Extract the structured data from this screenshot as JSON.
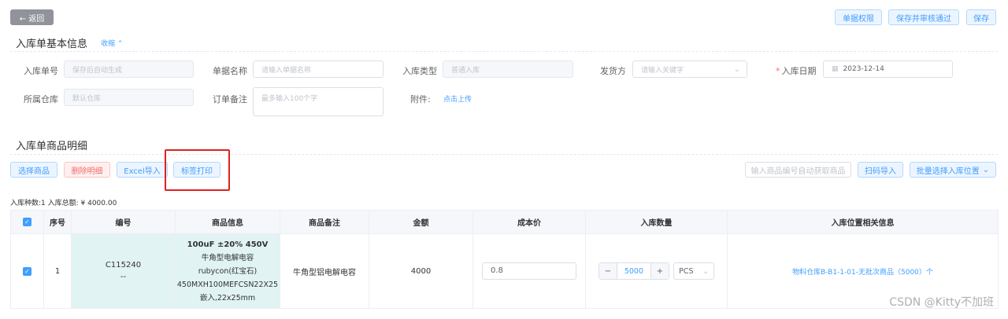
{
  "toolbar": {
    "back_label": "← 返回",
    "permission_label": "单据权限",
    "save_approve_label": "保存并审核通过",
    "save_label": "保存"
  },
  "basic": {
    "title": "入库单基本信息",
    "collapse_label": "收缩",
    "order_no": {
      "label": "入库单号",
      "placeholder": "保存后自动生成"
    },
    "doc_name": {
      "label": "单据名称",
      "placeholder": "请输入单据名称"
    },
    "in_type": {
      "label": "入库类型",
      "value": "普通入库"
    },
    "shipper": {
      "label": "发货方",
      "placeholder": "请输入关键字"
    },
    "in_date": {
      "label": "入库日期",
      "required_mark": "*",
      "value": "2023-12-14"
    },
    "warehouse": {
      "label": "所属仓库",
      "value": "默认仓库"
    },
    "remark": {
      "label": "订单备注",
      "placeholder": "最多输入100个字"
    },
    "attachment": {
      "label": "附件:",
      "upload_label": "点击上传"
    }
  },
  "detail": {
    "title": "入库单商品明细",
    "select_goods_label": "选择商品",
    "delete_label": "删除明细",
    "excel_label": "Excel导入",
    "print_label": "标签打印",
    "code_input_label": "输入商品编号自动获取商品",
    "scan_label": "扫码导入",
    "batch_label": "批量选择入库位置",
    "summary": "入库种数:1   入库总额: ¥ 4000.00"
  },
  "table": {
    "headers": [
      "",
      "序号",
      "编号",
      "商品信息",
      "商品备注",
      "金额",
      "成本价",
      "入库数量",
      "入库位置相关信息"
    ],
    "row": {
      "index": "1",
      "code": "C115240",
      "code_sub": "--",
      "info_title": "100uF ±20% 450V",
      "info_lines": [
        "牛角型电解电容",
        "rubycon(红宝石)",
        "450MXH100MEFCSN22X25",
        "嵌入,22x25mm"
      ],
      "remark": "牛角型铝电解电容",
      "amount": "4000",
      "cost": "0.8",
      "qty": "5000",
      "minus": "−",
      "plus": "+",
      "unit": "PCS",
      "location": "物料仓库B-B1-1-01-无批次商品（5000）个"
    }
  },
  "watermark": "CSDN @Kitty不加班",
  "colors": {
    "primary": "#409eff",
    "danger": "#f56c6c",
    "highlight": "#e1f3f3",
    "annotation": "#e02020"
  }
}
